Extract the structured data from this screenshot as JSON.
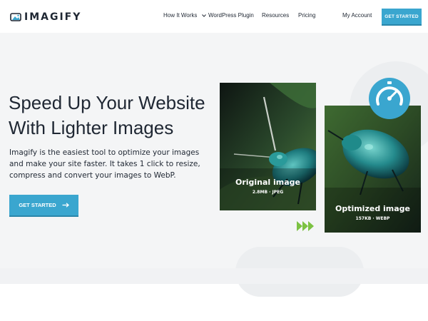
{
  "nav": {
    "logo_text": "IMAGIFY",
    "items": [
      {
        "label": "How It Works",
        "has_caret": true
      },
      {
        "label": "WordPress Plugin"
      },
      {
        "label": "Resources"
      },
      {
        "label": "Pricing"
      }
    ],
    "account_label": "My Account",
    "cta_label": "GET STARTED"
  },
  "hero": {
    "title_line1": "Speed Up Your Website",
    "title_line2": "With Lighter Images",
    "description": "Imagify is the easiest tool to optimize your images and make your site faster. It takes 1 click to resize, compress and convert your images to WebP.",
    "cta_label": "GET STARTED",
    "cta_icon": "arrow-right-icon"
  },
  "comparison": {
    "original": {
      "title": "Original image",
      "meta": "2.8MB · JPEG"
    },
    "optimized": {
      "title": "Optimized image",
      "meta": "157KB · WEBP"
    },
    "gauge_icon": "speed-gauge-icon",
    "arrows_icon": "triple-chevron-right-icon"
  },
  "colors": {
    "accent": "#3aa6cf",
    "arrows": "#7cc242",
    "text": "#1f2733"
  }
}
